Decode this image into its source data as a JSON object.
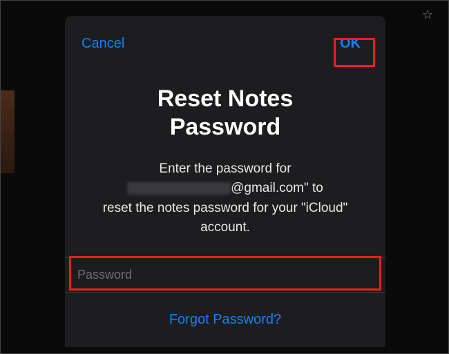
{
  "modal": {
    "cancel_label": "Cancel",
    "ok_label": "OK",
    "title_line1": "Reset Notes",
    "title_line2": "Password",
    "description_prefix": "Enter the password for",
    "description_email_suffix": "@gmail.com\" to",
    "description_line2": "reset the notes password for your \"iCloud\"",
    "description_line3": "account.",
    "password_placeholder": "Password",
    "password_value": "",
    "forgot_label": "Forgot Password?"
  },
  "icons": {
    "star": "☆"
  },
  "colors": {
    "accent": "#0a84ff",
    "highlight": "#e82020",
    "background": "#1d1d1f"
  }
}
